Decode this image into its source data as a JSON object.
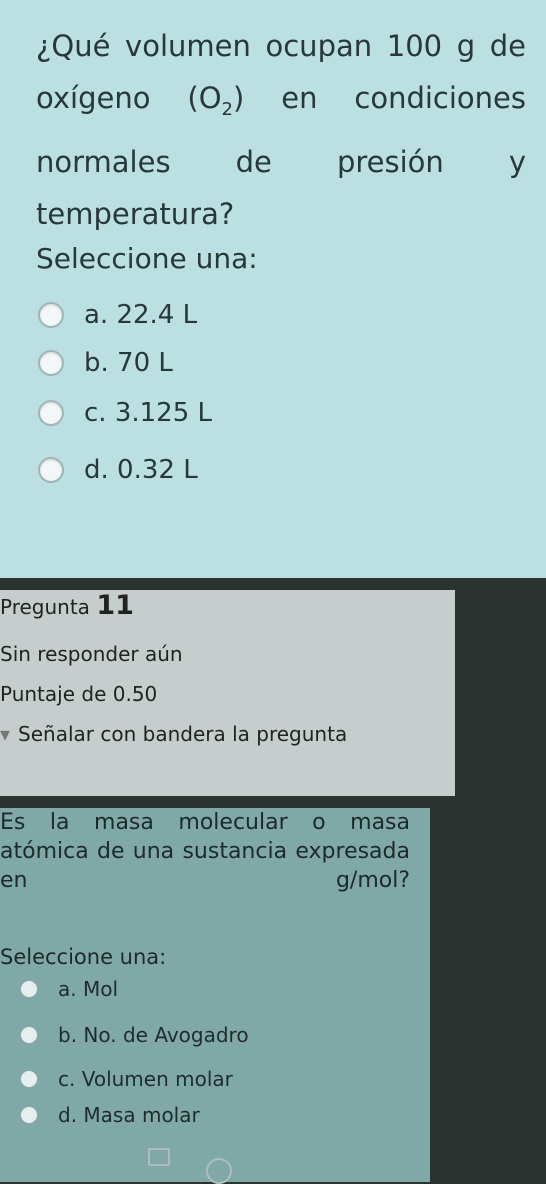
{
  "question1": {
    "text_before_formula": "¿Qué volumen ocupan 100 g de oxígeno ",
    "formula_base": "O",
    "formula_sub": "2",
    "text_after_formula": " en condiciones normales de presión y temperatura?",
    "select_label": "Seleccione una:",
    "options": [
      {
        "label": "a. 22.4 L"
      },
      {
        "label": "b. 70 L"
      },
      {
        "label": "c. 3.125 L"
      },
      {
        "label": "d. 0.32 L"
      }
    ]
  },
  "question2_info": {
    "prefix": "Pregunta",
    "number": "11",
    "status": "Sin responder aún",
    "points": "Puntaje de 0.50",
    "flag_label": "Señalar con bandera la pregunta"
  },
  "question2": {
    "text": "Es la masa molecular o masa atómica de una sustancia expresada en g/mol?",
    "select_label": "Seleccione una:",
    "options": [
      {
        "label": "a. Mol"
      },
      {
        "label": "b. No. de Avogadro"
      },
      {
        "label": "c. Volumen molar"
      },
      {
        "label": "d. Masa molar"
      }
    ]
  }
}
